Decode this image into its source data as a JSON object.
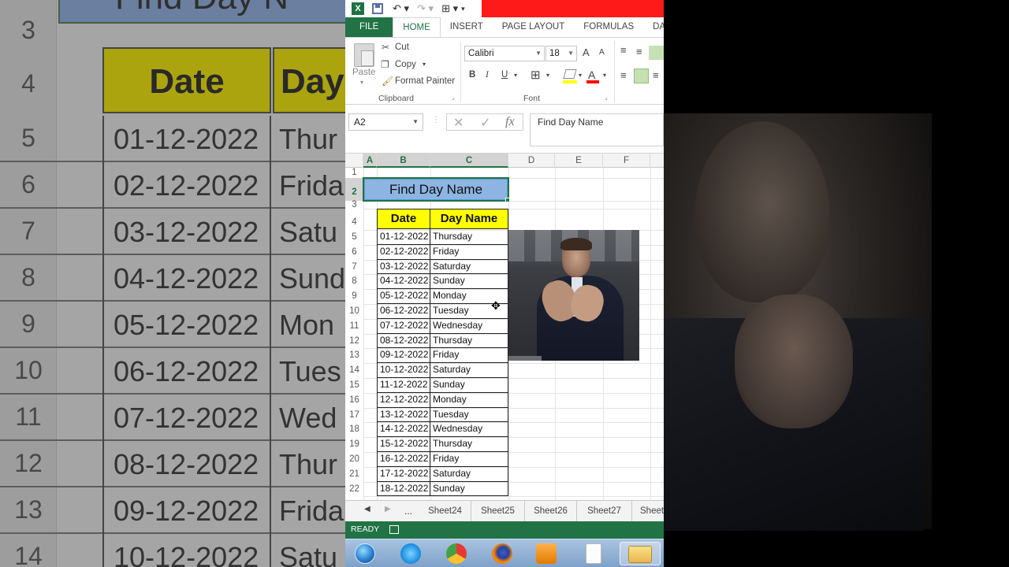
{
  "background": {
    "title": "Find Day N",
    "header_date": "Date",
    "header_day": "Day",
    "rows": [
      {
        "num": "3",
        "date": "",
        "day": ""
      },
      {
        "num": "5",
        "date": "01-12-2022",
        "day": "Thur"
      },
      {
        "num": "6",
        "date": "02-12-2022",
        "day": "Frida"
      },
      {
        "num": "7",
        "date": "03-12-2022",
        "day": "Satu"
      },
      {
        "num": "8",
        "date": "04-12-2022",
        "day": "Sund"
      },
      {
        "num": "9",
        "date": "05-12-2022",
        "day": "Mon"
      },
      {
        "num": "10",
        "date": "06-12-2022",
        "day": "Tues"
      },
      {
        "num": "11",
        "date": "07-12-2022",
        "day": "Wed"
      },
      {
        "num": "12",
        "date": "08-12-2022",
        "day": "Thur"
      },
      {
        "num": "13",
        "date": "09-12-2022",
        "day": "Frida"
      },
      {
        "num": "14",
        "date": "10-12-2022",
        "day": "Satu"
      }
    ],
    "header_row_num": "4",
    "top_row_num": "2"
  },
  "excel": {
    "qat": {
      "app_icon": "X"
    },
    "tabs": [
      "FILE",
      "HOME",
      "INSERT",
      "PAGE LAYOUT",
      "FORMULAS",
      "DATA"
    ],
    "ribbon": {
      "paste": "Paste",
      "cut": "Cut",
      "copy": "Copy",
      "format_painter": "Format Painter",
      "clipboard_label": "Clipboard",
      "font_name": "Calibri",
      "font_size": "18",
      "bold": "B",
      "italic": "I",
      "underline": "U",
      "font_label": "Font",
      "font_grow": "A",
      "font_shrink": "A",
      "font_color": "A"
    },
    "name_box": "A2",
    "formula": "Find Day Name",
    "columns": [
      "A",
      "B",
      "C",
      "D",
      "E",
      "F"
    ],
    "row_numbers": [
      "1",
      "2",
      "3",
      "4",
      "5",
      "6",
      "7",
      "8",
      "9",
      "10",
      "11",
      "12",
      "13",
      "14",
      "15",
      "16",
      "17",
      "18",
      "19",
      "20",
      "21",
      "22"
    ],
    "title_cell": "Find Day Name",
    "table": {
      "headers": [
        "Date",
        "Day Name"
      ],
      "rows": [
        [
          "01-12-2022",
          "Thursday"
        ],
        [
          "02-12-2022",
          "Friday"
        ],
        [
          "03-12-2022",
          "Saturday"
        ],
        [
          "04-12-2022",
          "Sunday"
        ],
        [
          "05-12-2022",
          "Monday"
        ],
        [
          "06-12-2022",
          "Tuesday"
        ],
        [
          "07-12-2022",
          "Wednesday"
        ],
        [
          "08-12-2022",
          "Thursday"
        ],
        [
          "09-12-2022",
          "Friday"
        ],
        [
          "10-12-2022",
          "Saturday"
        ],
        [
          "11-12-2022",
          "Sunday"
        ],
        [
          "12-12-2022",
          "Monday"
        ],
        [
          "13-12-2022",
          "Tuesday"
        ],
        [
          "14-12-2022",
          "Wednesday"
        ],
        [
          "15-12-2022",
          "Thursday"
        ],
        [
          "16-12-2022",
          "Friday"
        ],
        [
          "17-12-2022",
          "Saturday"
        ],
        [
          "18-12-2022",
          "Sunday"
        ]
      ]
    },
    "sheets": {
      "ellipsis": "...",
      "tabs": [
        "Sheet24",
        "Sheet25",
        "Sheet26",
        "Sheet27",
        "Sheet"
      ]
    },
    "status": "READY"
  },
  "taskbar": {
    "apps": [
      "start-orb",
      "internet-explorer",
      "chrome",
      "firefox",
      "media-player",
      "notepad",
      "file-explorer"
    ]
  },
  "colors": {
    "excel_green": "#217346",
    "header_yellow": "#ffff00",
    "title_blue": "#8db4e2",
    "red_banner": "#ff1a1a"
  }
}
